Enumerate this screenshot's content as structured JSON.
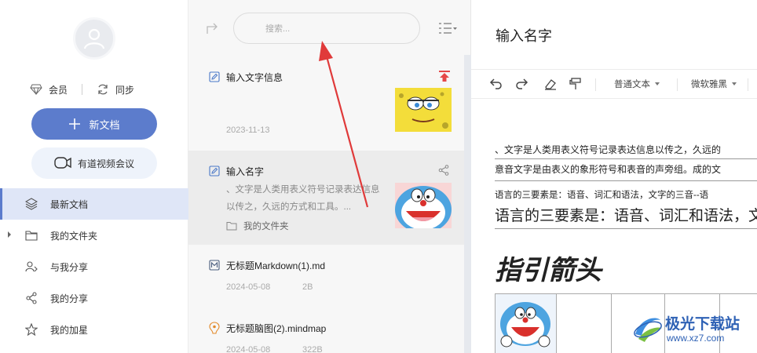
{
  "sidebar": {
    "vip_label": "会员",
    "sync_label": "同步",
    "new_doc_label": "新文档",
    "meeting_label": "有道视频会议",
    "nav": [
      {
        "label": "最新文档",
        "icon": "layers-icon"
      },
      {
        "label": "我的文件夹",
        "icon": "folder-icon"
      },
      {
        "label": "与我分享",
        "icon": "people-share-icon"
      },
      {
        "label": "我的分享",
        "icon": "share-icon"
      },
      {
        "label": "我的加星",
        "icon": "star-icon"
      }
    ]
  },
  "list": {
    "search_placeholder": "搜索...",
    "items": [
      {
        "title": "输入文字信息",
        "date": "2023-11-13",
        "icon": "note-edit-icon",
        "pinned": true
      },
      {
        "title": "输入名字",
        "snippet": "、文字是人类用表义符号记录表达信息以传之，久远的方式和工具。...",
        "folder": "我的文件夹",
        "icon": "note-edit-icon"
      },
      {
        "title": "无标题Markdown(1).md",
        "date": "2024-05-08",
        "size": "2B",
        "icon": "markdown-icon"
      },
      {
        "title": "无标题脑图(2).mindmap",
        "date": "2024-05-08",
        "size": "322B",
        "icon": "mindmap-icon"
      }
    ]
  },
  "editor": {
    "title": "输入名字",
    "toolbar": {
      "style_label": "普通文本",
      "font_label": "微软雅黑"
    },
    "lines": [
      "、文字是人类用表义符号记录表达信息以传之，久远的",
      "意音文字是由表义的象形符号和表音的声旁组。成的文",
      "语言的三要素是：语音、词汇和语法，文字的三音--语",
      "语言的三要素是：语音、词汇和语法，文"
    ],
    "heading": "指引箭头"
  },
  "watermark": {
    "text": "极光下载站",
    "url": "www.xz7.com"
  },
  "colors": {
    "accent": "#5c7ccc",
    "arrow": "#e03a3a",
    "watermark": "#2f62b5"
  }
}
